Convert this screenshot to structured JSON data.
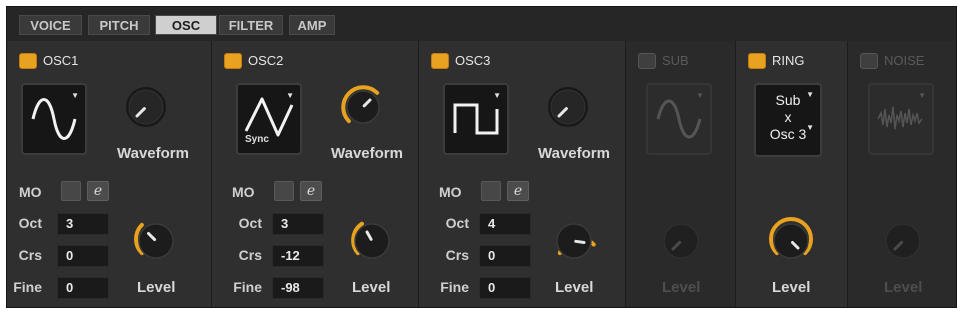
{
  "tabs": [
    {
      "label": "VOICE",
      "active": false
    },
    {
      "label": "PITCH",
      "active": false
    },
    {
      "label": "OSC",
      "active": true
    },
    {
      "label": "FILTER",
      "active": false
    },
    {
      "label": "AMP",
      "active": false
    }
  ],
  "osc1": {
    "title": "OSC1",
    "enabled": true,
    "waveform_name": "sine",
    "waveform_label": "Waveform",
    "mo_label": "MO",
    "e_label": "e",
    "oct_label": "Oct",
    "oct": "3",
    "crs_label": "Crs",
    "crs": "0",
    "fine_label": "Fine",
    "fine": "0",
    "level_label": "Level"
  },
  "osc2": {
    "title": "OSC2",
    "enabled": true,
    "waveform_name": "sync-triangle",
    "sync_label": "Sync",
    "waveform_label": "Waveform",
    "mo_label": "MO",
    "e_label": "e",
    "oct_label": "Oct",
    "oct": "3",
    "crs_label": "Crs",
    "crs": "-12",
    "fine_label": "Fine",
    "fine": "-98",
    "level_label": "Level"
  },
  "osc3": {
    "title": "OSC3",
    "enabled": true,
    "waveform_name": "square",
    "waveform_label": "Waveform",
    "mo_label": "MO",
    "e_label": "e",
    "oct_label": "Oct",
    "oct": "4",
    "crs_label": "Crs",
    "crs": "0",
    "fine_label": "Fine",
    "fine": "0",
    "level_label": "Level"
  },
  "sub": {
    "title": "SUB",
    "enabled": false,
    "waveform_name": "sine",
    "level_label": "Level"
  },
  "ring": {
    "title": "RING",
    "enabled": true,
    "source_line1": "Sub",
    "source_line2": "x",
    "source_line3": "Osc 3",
    "level_label": "Level"
  },
  "noise": {
    "title": "NOISE",
    "enabled": false,
    "waveform_name": "noise",
    "level_label": "Level"
  },
  "colors": {
    "accent": "#e9a21f",
    "panel": "#2b2b2b",
    "display": "#161616",
    "text": "#d8d8d8",
    "dim_text": "#4e4e4e"
  }
}
